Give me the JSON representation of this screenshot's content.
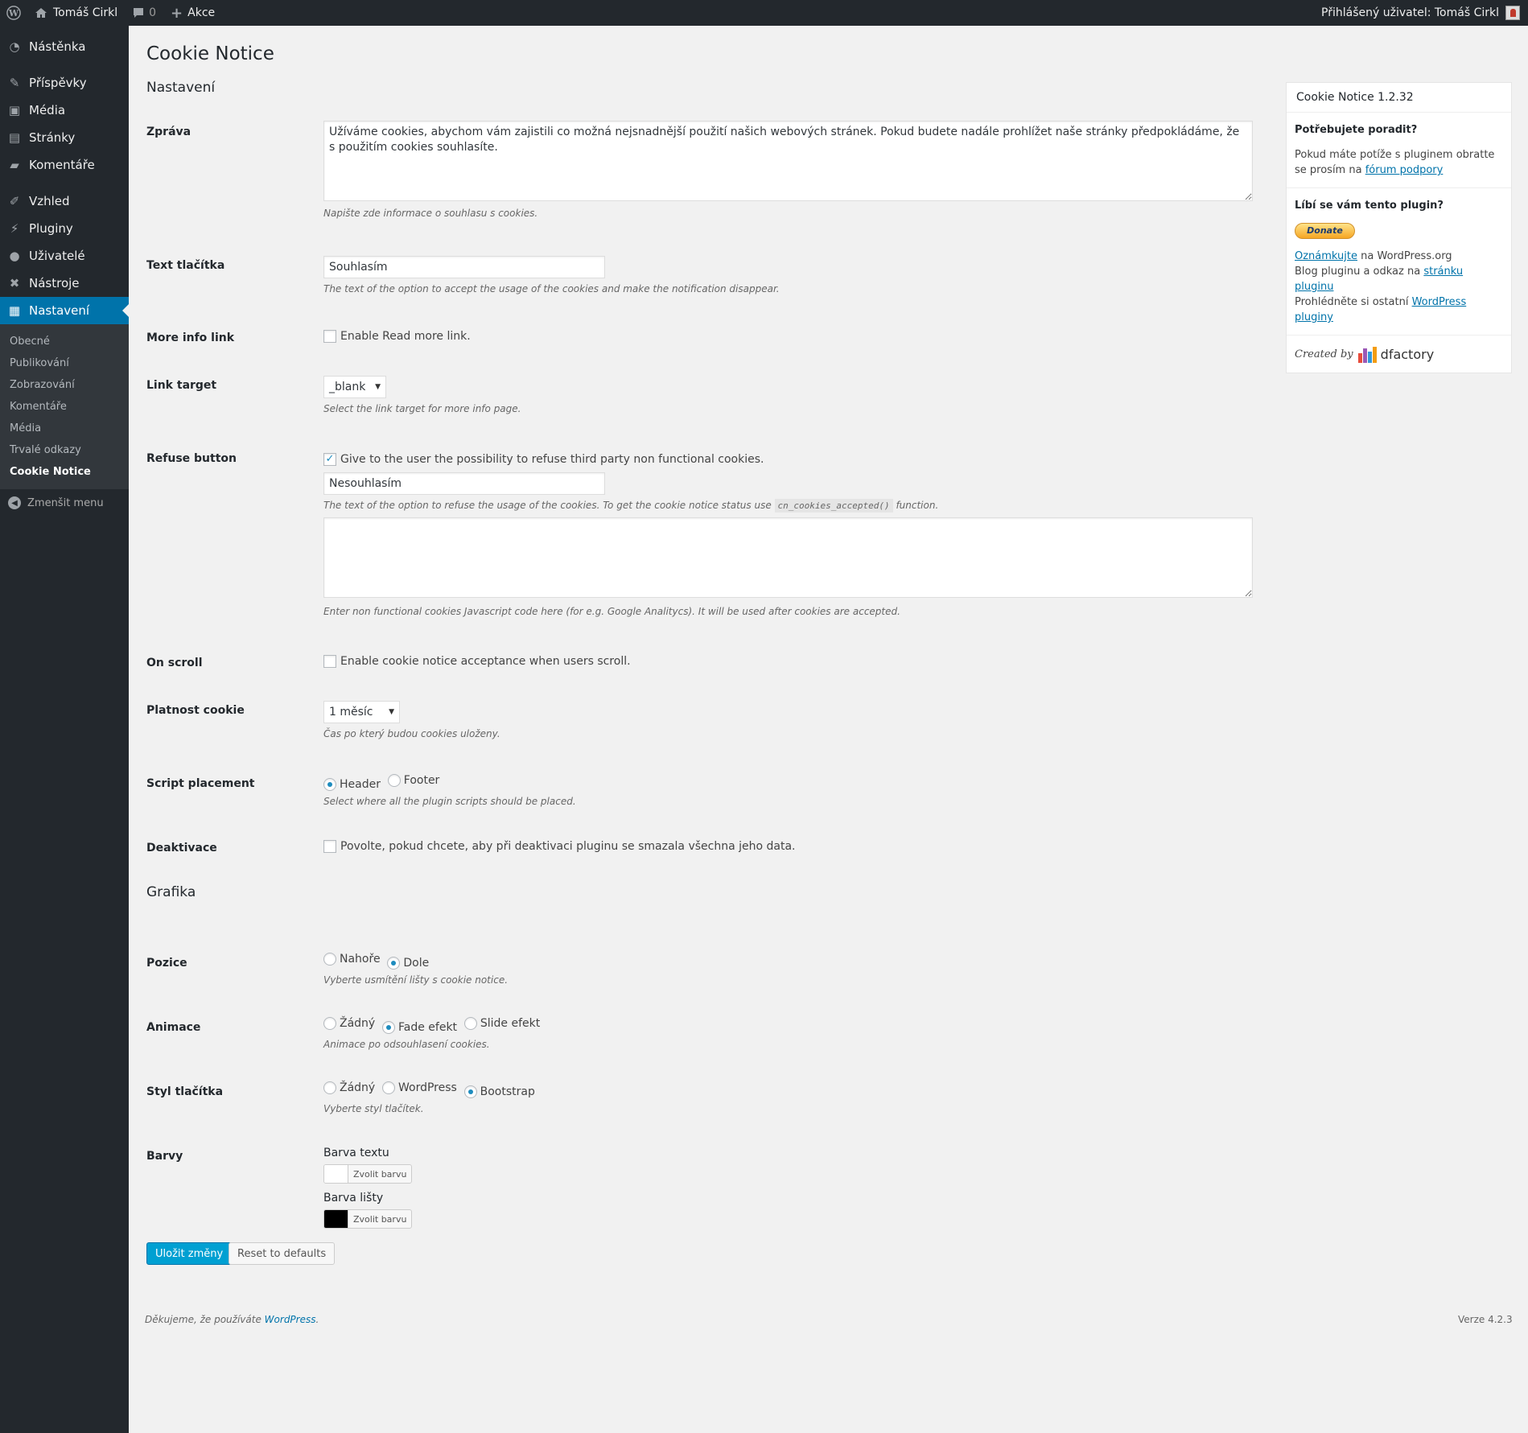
{
  "adminbar": {
    "site_name": "Tomáš Cirkl",
    "comments_count": "0",
    "new_label": "Akce",
    "user_greeting": "Přihlášený uživatel: Tomáš Cirkl"
  },
  "sidebar": {
    "items": [
      {
        "label": "Nástěnka",
        "icon": "dashboard-icon"
      },
      {
        "label": "Příspěvky",
        "icon": "pin-icon"
      },
      {
        "label": "Média",
        "icon": "media-icon"
      },
      {
        "label": "Stránky",
        "icon": "pages-icon"
      },
      {
        "label": "Komentáře",
        "icon": "comments-icon"
      },
      {
        "label": "Vzhled",
        "icon": "appearance-icon"
      },
      {
        "label": "Pluginy",
        "icon": "plugins-icon"
      },
      {
        "label": "Uživatelé",
        "icon": "users-icon"
      },
      {
        "label": "Nástroje",
        "icon": "tools-icon"
      },
      {
        "label": "Nastavení",
        "icon": "settings-icon"
      }
    ],
    "submenu": [
      "Obecné",
      "Publikování",
      "Zobrazování",
      "Komentáře",
      "Média",
      "Trvalé odkazy",
      "Cookie Notice"
    ],
    "collapse_label": "Zmenšit menu"
  },
  "page": {
    "title": "Cookie Notice",
    "section_settings": "Nastavení",
    "section_graphics": "Grafika"
  },
  "form": {
    "message": {
      "label": "Zpráva",
      "value": "Užíváme cookies, abychom vám zajistili co možná nejsnadnější použití našich webových stránek. Pokud budete nadále prohlížet naše stránky předpokládáme, že s použitím cookies souhlasíte.",
      "desc": "Napište zde informace o souhlasu s cookies."
    },
    "button_text": {
      "label": "Text tlačítka",
      "value": "Souhlasím",
      "desc": "The text of the option to accept the usage of the cookies and make the notification disappear."
    },
    "more_info": {
      "label": "More info link",
      "checkbox": "Enable Read more link.",
      "checked": false
    },
    "link_target": {
      "label": "Link target",
      "value": "_blank",
      "desc": "Select the link target for more info page."
    },
    "refuse": {
      "label": "Refuse button",
      "checkbox": "Give to the user the possibility to refuse third party non functional cookies.",
      "checked": true,
      "value": "Nesouhlasím",
      "desc_before": "The text of the option to refuse the usage of the cookies. To get the cookie notice status use",
      "code": "cn_cookies_accepted()",
      "desc_after": "function.",
      "code_value": "",
      "code_desc": "Enter non functional cookies Javascript code here (for e.g. Google Analitycs). It will be used after cookies are accepted."
    },
    "on_scroll": {
      "label": "On scroll",
      "checkbox": "Enable cookie notice acceptance when users scroll.",
      "checked": false
    },
    "expiry": {
      "label": "Platnost cookie",
      "value": "1 měsíc",
      "desc": "Čas po který budou cookies uloženy."
    },
    "script_placement": {
      "label": "Script placement",
      "options": [
        "Header",
        "Footer"
      ],
      "selected": "Header",
      "desc": "Select where all the plugin scripts should be placed."
    },
    "deactivation": {
      "label": "Deaktivace",
      "checkbox": "Povolte, pokud chcete, aby při deaktivaci pluginu se smazala všechna jeho data.",
      "checked": false
    },
    "position": {
      "label": "Pozice",
      "options": [
        "Nahoře",
        "Dole"
      ],
      "selected": "Dole",
      "desc": "Vyberte usmítění lišty s cookie notice."
    },
    "animation": {
      "label": "Animace",
      "options": [
        "Žádný",
        "Fade efekt",
        "Slide efekt"
      ],
      "selected": "Fade efekt",
      "desc": "Animace po odsouhlasení cookies."
    },
    "button_style": {
      "label": "Styl tlačítka",
      "options": [
        "Žádný",
        "WordPress",
        "Bootstrap"
      ],
      "selected": "Bootstrap",
      "desc": "Vyberte styl tlačítek."
    },
    "colors": {
      "label": "Barvy",
      "text_color_label": "Barva textu",
      "text_color": "#ffffff",
      "bar_color_label": "Barva lišty",
      "bar_color": "#000000",
      "pick_label": "Zvolit barvu"
    },
    "save_label": "Uložit změny",
    "reset_label": "Reset to defaults"
  },
  "widget": {
    "title": "Cookie Notice 1.2.32",
    "help_head": "Potřebujete poradit?",
    "help_text": "Pokud máte potíže s pluginem obratte se prosím na",
    "help_link": "fórum podpory",
    "like_head": "Líbí se vám tento plugin?",
    "donate_label": "Donate",
    "rate_link": "Oznámkujte",
    "rate_text": "na WordPress.org",
    "blog_text": "Blog pluginu a odkaz na",
    "blog_link": "stránku pluginu",
    "other_text": "Prohlédněte si ostatní",
    "other_link": "WordPress pluginy",
    "created_by": "Created by",
    "brand": "dfactory"
  },
  "footer": {
    "thanks": "Děkujeme, že používáte",
    "wp_link": "WordPress",
    "version": "Verze 4.2.3"
  },
  "colors": {
    "accent": "#0073aa",
    "primary_button": "#00a0d2",
    "sidebar_bg": "#23282d"
  }
}
